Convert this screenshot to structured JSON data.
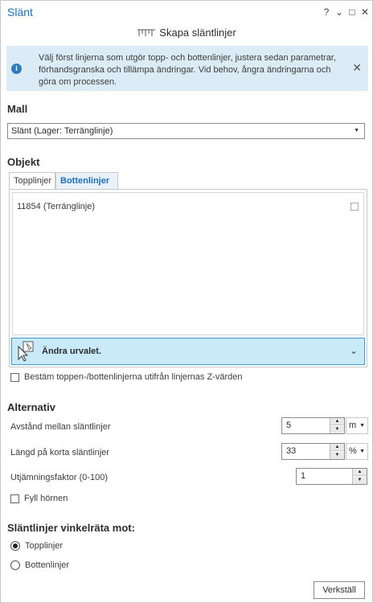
{
  "window": {
    "title": "Slänt",
    "help": "?",
    "menu": "⌄",
    "maximize": "□",
    "close": "✕"
  },
  "tool": {
    "heading": "Skapa släntlinjer",
    "icon": "slope-lines-icon"
  },
  "info": {
    "text": "Välj först linjerna som utgör topp- och bottenlinjer, justera sedan parametrar, förhandsgranska och tillämpa ändringar. Vid behov, ångra ändringarna och göra om processen.",
    "icon": "i",
    "close": "✕"
  },
  "template": {
    "section_title": "Mall",
    "value": "Slänt (Lager: Terränglinje)"
  },
  "objects": {
    "section_title": "Objekt",
    "tabs": [
      {
        "label": "Topplinjer",
        "active": false
      },
      {
        "label": "Bottenlinjer",
        "active": true
      }
    ],
    "items": [
      "11854 (Terränglinje)"
    ],
    "change_selection": "Ändra urvalet."
  },
  "z_checkbox": {
    "label": "Bestäm toppen-/bottenlinjerna utifrån linjernas Z-värden",
    "checked": false
  },
  "options": {
    "section_title": "Alternativ",
    "spacing": {
      "label": "Avstånd mellan släntlinjer",
      "value": "5",
      "unit": "m"
    },
    "short_length": {
      "label": "Längd på korta släntlinjer",
      "value": "33",
      "unit": "%"
    },
    "smoothing": {
      "label": "Utjämningsfaktor (0-100)",
      "value": "1"
    },
    "fill_corners": {
      "label": "Fyll hörnen",
      "checked": false
    }
  },
  "perpendicular": {
    "section_title": "Släntlinjer vinkelräta mot:",
    "options": [
      {
        "label": "Topplinjer",
        "checked": true
      },
      {
        "label": "Bottenlinjer",
        "checked": false
      }
    ]
  },
  "apply_label": "Verkställ",
  "colors": {
    "accent": "#1f6fb5",
    "info_bg": "#dcecf7",
    "selection_bg": "#c9eaf9"
  }
}
